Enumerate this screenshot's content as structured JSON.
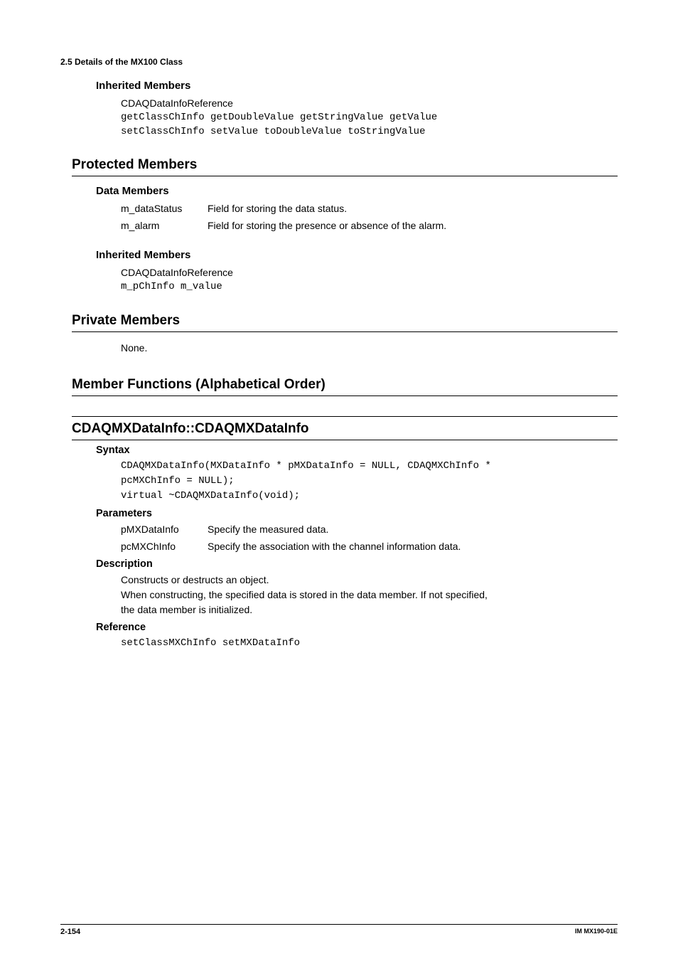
{
  "header": {
    "section": "2.5  Details of the MX100 Class"
  },
  "inherited1": {
    "title": "Inherited Members",
    "ref": "CDAQDataInfoReference",
    "line1": "getClassChInfo getDoubleValue getStringValue getValue",
    "line2": "setClassChInfo setValue toDoubleValue toStringValue"
  },
  "protected": {
    "title": "Protected Members"
  },
  "dataMembers": {
    "title": "Data Members",
    "rows": [
      {
        "label": "m_dataStatus",
        "desc": "Field for storing the data status."
      },
      {
        "label": "m_alarm",
        "desc": "Field for storing the presence or absence of the alarm."
      }
    ]
  },
  "inherited2": {
    "title": "Inherited Members",
    "ref": "CDAQDataInfoReference",
    "line1": "m_pChInfo m_value"
  },
  "private": {
    "title": "Private Members",
    "body": "None."
  },
  "memberFuncs": {
    "title": "Member Functions (Alphabetical Order)"
  },
  "method": {
    "name": "CDAQMXDataInfo::CDAQMXDataInfo",
    "syntax": {
      "title": "Syntax",
      "line1": "CDAQMXDataInfo(MXDataInfo * pMXDataInfo = NULL, CDAQMXChInfo *",
      "line2": "pcMXChInfo = NULL);",
      "line3": "virtual ~CDAQMXDataInfo(void);"
    },
    "parameters": {
      "title": "Parameters",
      "rows": [
        {
          "label": "pMXDataInfo",
          "desc": "Specify the measured data."
        },
        {
          "label": "pcMXChInfo",
          "desc": "Specify the association with the channel information data."
        }
      ]
    },
    "description": {
      "title": "Description",
      "line1": "Constructs or destructs an object.",
      "line2": "When constructing, the specified data is stored in the data member. If not specified,",
      "line3": "the data member is initialized."
    },
    "reference": {
      "title": "Reference",
      "line1": "setClassMXChInfo setMXDataInfo"
    }
  },
  "footer": {
    "pageNum": "2-154",
    "docId": "IM MX190-01E"
  }
}
